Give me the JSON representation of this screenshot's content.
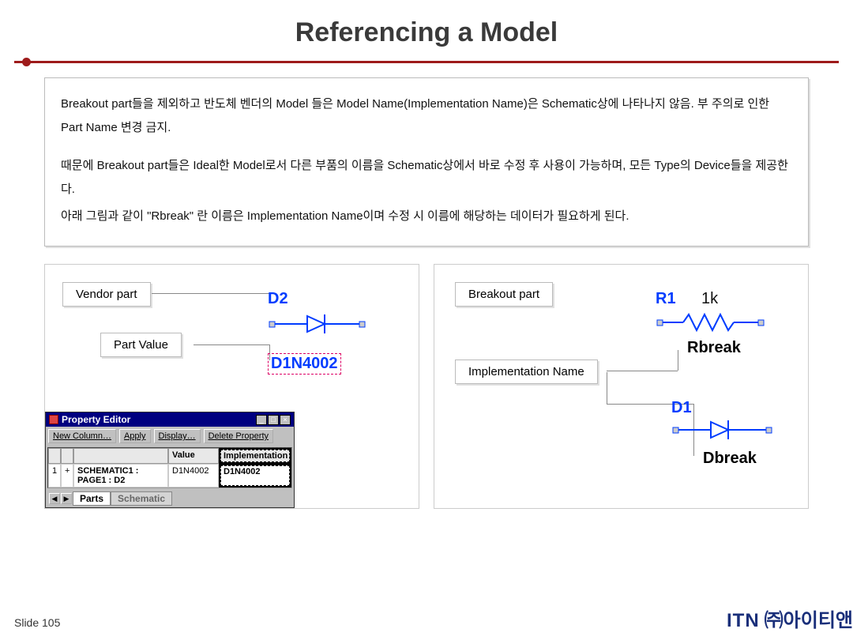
{
  "title": "Referencing a Model",
  "info": {
    "p1": "Breakout part들을 제외하고 반도체 벤더의 Model 들은 Model Name(Implementation Name)은 Schematic상에 나타나지 않음. 부 주의로 인한 Part Name 변경 금지.",
    "p2": "때문에 Breakout part들은 Ideal한 Model로서 다른 부품의 이름을 Schematic상에서 바로 수정 후 사용이 가능하며, 모든 Type의 Device들을 제공한다.",
    "p3": "아래 그림과 같이 \"Rbreak\" 란 이름은 Implementation Name이며 수정 시 이름에 해당하는 데이터가 필요하게 된다."
  },
  "left": {
    "vendor_label": "Vendor part",
    "partvalue_label": "Part Value",
    "diode_ref": "D2",
    "diode_value": "D1N4002"
  },
  "right": {
    "breakout_label": "Breakout part",
    "impl_label": "Implementation Name",
    "res_ref": "R1",
    "res_val": "1k",
    "res_break": "Rbreak",
    "d_ref": "D1",
    "d_break": "Dbreak"
  },
  "propedit": {
    "title": "Property Editor",
    "buttons": {
      "newcol": "New Column…",
      "apply": "Apply",
      "display": "Display…",
      "delete": "Delete Property"
    },
    "headers": {
      "value": "Value",
      "impl": "Implementation"
    },
    "row": {
      "num": "1",
      "name": "SCHEMATIC1 : PAGE1 : D2",
      "value": "D1N4002",
      "impl": "D1N4002"
    },
    "tabs": {
      "parts": "Parts",
      "schematic": "Schematic"
    }
  },
  "footer": {
    "slide": "Slide 105",
    "brand": "ITN",
    "brand_kr": "㈜아이티앤"
  },
  "icons": {
    "min": "_",
    "max": "□",
    "close": "×",
    "left": "◀",
    "right": "▶",
    "plus": "+"
  }
}
